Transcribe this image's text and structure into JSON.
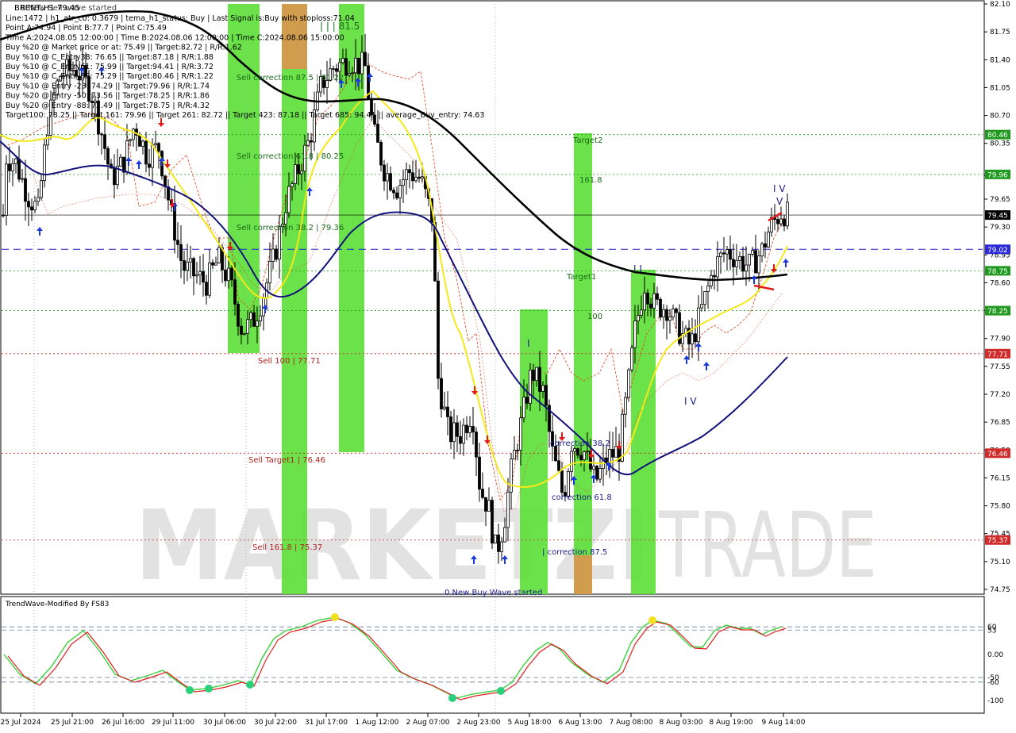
{
  "chart_data": {
    "type": "candlestick",
    "symbol": "BRENT",
    "timeframe": "H1",
    "title": "BRENT,H1  79.45",
    "overlay_title": "0 New Sell wave started",
    "info_lines": [
      "Line:1472 | h1_atr_c0: 0.3679 | tema_h1_status: Buy | Last Signal is:Buy with stoploss:71.04",
      "Point A:74.94 | Point B:77.7 | Point C:75.49",
      "Time A:2024.08.05 12:00:00 | Time B:2024.08.06 12:00:00 | Time C:2024.08.06 15:00:00",
      "Buy %20 @ Market price or at: 75.49 || Target:82.72 | R/R:1.62",
      "Buy %10 @ C_Entry38: 76.65 || Target:87.18 | R/R:1.88",
      "Buy %10 @ C_Entry61: 75.99 || Target:94.41 | R/R:3.72",
      "Buy %10 @ C_Entry88: 75.29 || Target:80.46 | R/R:1.22",
      "Buy %10 @ Entry -23: 74.29 || Target:79.96 | R/R:1.74",
      "Buy %20 @ Entry -50: 73.56 || Target:78.25 | R/R:1.86",
      "Buy %20 @ Entry -88: 72.49 || Target:78.75 | R/R:4.32",
      "Target100: 78.25 || Target 161: 79.96 || Target 261: 82.72 || Target 423: 87.18 || Target 685: 94.41 || average_Buy_entry: 74.63"
    ],
    "y_ticks": [
      "82.10",
      "81.75",
      "81.40",
      "81.05",
      "80.70",
      "80.35",
      "79.95",
      "79.65",
      "79.30",
      "78.95",
      "78.60",
      "78.25",
      "77.90",
      "77.55",
      "77.20",
      "76.85",
      "76.50",
      "76.15",
      "75.80",
      "75.45",
      "75.10",
      "74.75"
    ],
    "ylim": [
      74.65,
      82.15
    ],
    "x_ticks": [
      "25 Jul 2024",
      "25 Jul 21:00",
      "26 Jul 16:00",
      "29 Jul 11:00",
      "30 Jul 06:00",
      "30 Jul 22:00",
      "31 Jul 17:00",
      "1 Aug 12:00",
      "2 Aug 07:00",
      "2 Aug 23:00",
      "5 Aug 18:00",
      "6 Aug 13:00",
      "7 Aug 08:00",
      "8 Aug 03:00",
      "8 Aug 19:00",
      "9 Aug 14:00"
    ],
    "price_levels": [
      {
        "value": 80.46,
        "label": "80.46",
        "color": "#1a9a1a",
        "style": "dotted"
      },
      {
        "value": 79.96,
        "label": "79.96",
        "color": "#1a9a1a",
        "style": "dotted"
      },
      {
        "value": 79.45,
        "label": "79.45",
        "color": "#000000",
        "style": "solid-thin"
      },
      {
        "value": 79.02,
        "label": "79.02",
        "color": "#2222cc",
        "style": "dashed"
      },
      {
        "value": 78.75,
        "label": "78.75",
        "color": "#1a9a1a",
        "style": "dotted"
      },
      {
        "value": 78.25,
        "label": "78.25",
        "color": "#1a9a1a",
        "style": "dotted"
      },
      {
        "value": 77.71,
        "label": "77.71",
        "color": "#cc2222",
        "style": "dotted"
      },
      {
        "value": 76.46,
        "label": "76.46",
        "color": "#cc2222",
        "style": "dotted"
      },
      {
        "value": 75.37,
        "label": "75.37",
        "color": "#cc2222",
        "style": "dotted"
      }
    ],
    "annotations": [
      {
        "text": "| | | 81.5",
        "color": "#1a6a1a"
      },
      {
        "text": "Sell correction 87.5 | 81.22",
        "color": "#1a6a1a"
      },
      {
        "text": "Sell correction 61.8 | 80.25",
        "color": "#1a6a1a"
      },
      {
        "text": "Sell correction 38.2 | 79.36",
        "color": "#1a6a1a"
      },
      {
        "text": "Sell 100 | 77.71",
        "color": "#b02020"
      },
      {
        "text": "Sell Target1 | 76.46",
        "color": "#b02020"
      },
      {
        "text": "Sell 161.8 | 75.37",
        "color": "#b02020"
      },
      {
        "text": "Target2",
        "color": "#1a6a1a"
      },
      {
        "text": "161.8",
        "color": "#1a6a1a"
      },
      {
        "text": "Target1",
        "color": "#1a6a1a"
      },
      {
        "text": "100",
        "color": "#1a6a1a"
      },
      {
        "text": "I V",
        "color": "#1a1a8a"
      },
      {
        "text": "V",
        "color": "#1a1a8a"
      },
      {
        "text": "I V",
        "color": "#1a1a8a"
      },
      {
        "text": "I",
        "color": "#1a1a8a"
      },
      {
        "text": "I I",
        "color": "#1a1a8a"
      },
      {
        "text": "correction 38.2",
        "color": "#1a1a8a"
      },
      {
        "text": "correction 61.8",
        "color": "#1a1a8a"
      },
      {
        "text": "| correction 87.5",
        "color": "#1a1a8a"
      },
      {
        "text": "0 New Buy Wave started",
        "color": "#1a1a8a"
      }
    ],
    "watermark": "MARKETZI TRADE",
    "indicator": {
      "name": "TrendWave-Modified By FS83",
      "y_ticks": [
        "60",
        "53",
        "0.00",
        "-50",
        "-60",
        "-100"
      ]
    }
  }
}
